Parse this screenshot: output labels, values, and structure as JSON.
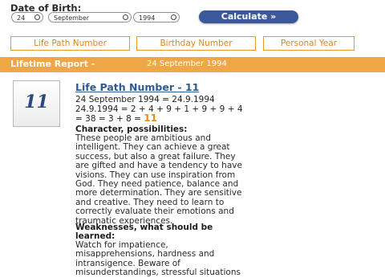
{
  "form": {
    "dob_label": "Date of Birth:",
    "day": "24",
    "month": "September",
    "year": "1994",
    "calculate_label": "Calculate »"
  },
  "tabs": [
    "Life Path Number",
    "Birthday Number",
    "Personal Year"
  ],
  "banner": {
    "title": "Lifetime Report -",
    "date": "24 September 1994"
  },
  "report": {
    "number": "11",
    "heading_prefix": "Life Path Number - ",
    "heading_number": "11",
    "calc_line1": "24 September 1994 = 24.9.1994",
    "calc_line2": "24.9.1994 = 2 + 4 + 9 + 1 + 9 + 9 + 4",
    "calc_line3": "= 38 = 3 + 8 = ",
    "calc_result": "11",
    "character_heading": "Character, possibilities:",
    "character_lines": [
      "These people are ambitious and",
      "intelligent. They can achieve a great",
      "success, but also a great failure. They",
      "are gifted and have a tendency to have",
      "visions. They can use inspiration from",
      "God. They need patience, balance and",
      "more determination. They are sensitive",
      "and creative. They need to learn to",
      "correctly evaluate their emotions and",
      "traumatic experiences."
    ],
    "weakness_heading_1": "Weaknesses, what should be",
    "weakness_heading_2": "learned:",
    "weakness_lines": [
      "Watch for impatience,",
      "misapprehensions, hardness and",
      "intransigence. Beware of",
      "misunderstandings, stressful situations"
    ]
  },
  "colors": {
    "accent_orange": "#efa645",
    "button_blue": "#3b5998",
    "link_blue": "#2f5b93"
  }
}
